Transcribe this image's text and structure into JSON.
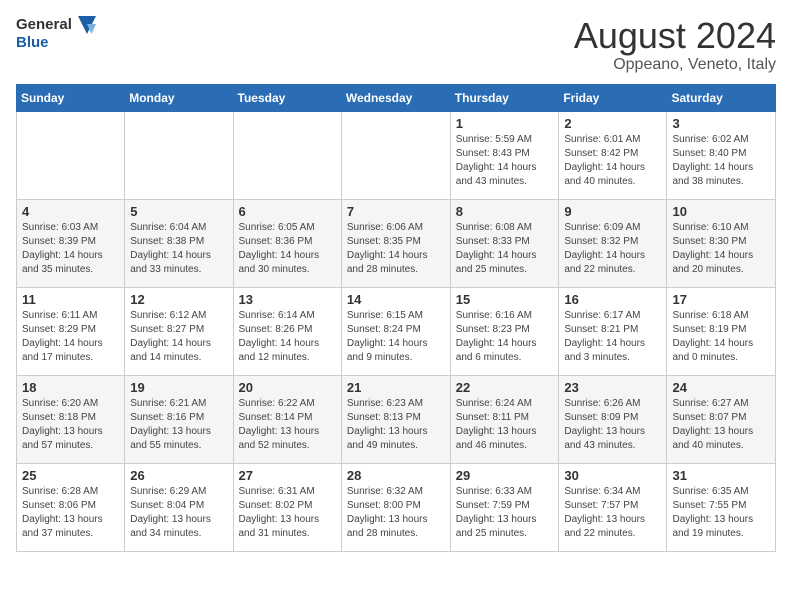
{
  "header": {
    "logo_general": "General",
    "logo_blue": "Blue",
    "main_title": "August 2024",
    "subtitle": "Oppeano, Veneto, Italy"
  },
  "calendar": {
    "days_of_week": [
      "Sunday",
      "Monday",
      "Tuesday",
      "Wednesday",
      "Thursday",
      "Friday",
      "Saturday"
    ],
    "weeks": [
      {
        "days": [
          {
            "number": "",
            "info": ""
          },
          {
            "number": "",
            "info": ""
          },
          {
            "number": "",
            "info": ""
          },
          {
            "number": "",
            "info": ""
          },
          {
            "number": "1",
            "info": "Sunrise: 5:59 AM\nSunset: 8:43 PM\nDaylight: 14 hours\nand 43 minutes."
          },
          {
            "number": "2",
            "info": "Sunrise: 6:01 AM\nSunset: 8:42 PM\nDaylight: 14 hours\nand 40 minutes."
          },
          {
            "number": "3",
            "info": "Sunrise: 6:02 AM\nSunset: 8:40 PM\nDaylight: 14 hours\nand 38 minutes."
          }
        ]
      },
      {
        "days": [
          {
            "number": "4",
            "info": "Sunrise: 6:03 AM\nSunset: 8:39 PM\nDaylight: 14 hours\nand 35 minutes."
          },
          {
            "number": "5",
            "info": "Sunrise: 6:04 AM\nSunset: 8:38 PM\nDaylight: 14 hours\nand 33 minutes."
          },
          {
            "number": "6",
            "info": "Sunrise: 6:05 AM\nSunset: 8:36 PM\nDaylight: 14 hours\nand 30 minutes."
          },
          {
            "number": "7",
            "info": "Sunrise: 6:06 AM\nSunset: 8:35 PM\nDaylight: 14 hours\nand 28 minutes."
          },
          {
            "number": "8",
            "info": "Sunrise: 6:08 AM\nSunset: 8:33 PM\nDaylight: 14 hours\nand 25 minutes."
          },
          {
            "number": "9",
            "info": "Sunrise: 6:09 AM\nSunset: 8:32 PM\nDaylight: 14 hours\nand 22 minutes."
          },
          {
            "number": "10",
            "info": "Sunrise: 6:10 AM\nSunset: 8:30 PM\nDaylight: 14 hours\nand 20 minutes."
          }
        ]
      },
      {
        "days": [
          {
            "number": "11",
            "info": "Sunrise: 6:11 AM\nSunset: 8:29 PM\nDaylight: 14 hours\nand 17 minutes."
          },
          {
            "number": "12",
            "info": "Sunrise: 6:12 AM\nSunset: 8:27 PM\nDaylight: 14 hours\nand 14 minutes."
          },
          {
            "number": "13",
            "info": "Sunrise: 6:14 AM\nSunset: 8:26 PM\nDaylight: 14 hours\nand 12 minutes."
          },
          {
            "number": "14",
            "info": "Sunrise: 6:15 AM\nSunset: 8:24 PM\nDaylight: 14 hours\nand 9 minutes."
          },
          {
            "number": "15",
            "info": "Sunrise: 6:16 AM\nSunset: 8:23 PM\nDaylight: 14 hours\nand 6 minutes."
          },
          {
            "number": "16",
            "info": "Sunrise: 6:17 AM\nSunset: 8:21 PM\nDaylight: 14 hours\nand 3 minutes."
          },
          {
            "number": "17",
            "info": "Sunrise: 6:18 AM\nSunset: 8:19 PM\nDaylight: 14 hours\nand 0 minutes."
          }
        ]
      },
      {
        "days": [
          {
            "number": "18",
            "info": "Sunrise: 6:20 AM\nSunset: 8:18 PM\nDaylight: 13 hours\nand 57 minutes."
          },
          {
            "number": "19",
            "info": "Sunrise: 6:21 AM\nSunset: 8:16 PM\nDaylight: 13 hours\nand 55 minutes."
          },
          {
            "number": "20",
            "info": "Sunrise: 6:22 AM\nSunset: 8:14 PM\nDaylight: 13 hours\nand 52 minutes."
          },
          {
            "number": "21",
            "info": "Sunrise: 6:23 AM\nSunset: 8:13 PM\nDaylight: 13 hours\nand 49 minutes."
          },
          {
            "number": "22",
            "info": "Sunrise: 6:24 AM\nSunset: 8:11 PM\nDaylight: 13 hours\nand 46 minutes."
          },
          {
            "number": "23",
            "info": "Sunrise: 6:26 AM\nSunset: 8:09 PM\nDaylight: 13 hours\nand 43 minutes."
          },
          {
            "number": "24",
            "info": "Sunrise: 6:27 AM\nSunset: 8:07 PM\nDaylight: 13 hours\nand 40 minutes."
          }
        ]
      },
      {
        "days": [
          {
            "number": "25",
            "info": "Sunrise: 6:28 AM\nSunset: 8:06 PM\nDaylight: 13 hours\nand 37 minutes."
          },
          {
            "number": "26",
            "info": "Sunrise: 6:29 AM\nSunset: 8:04 PM\nDaylight: 13 hours\nand 34 minutes."
          },
          {
            "number": "27",
            "info": "Sunrise: 6:31 AM\nSunset: 8:02 PM\nDaylight: 13 hours\nand 31 minutes."
          },
          {
            "number": "28",
            "info": "Sunrise: 6:32 AM\nSunset: 8:00 PM\nDaylight: 13 hours\nand 28 minutes."
          },
          {
            "number": "29",
            "info": "Sunrise: 6:33 AM\nSunset: 7:59 PM\nDaylight: 13 hours\nand 25 minutes."
          },
          {
            "number": "30",
            "info": "Sunrise: 6:34 AM\nSunset: 7:57 PM\nDaylight: 13 hours\nand 22 minutes."
          },
          {
            "number": "31",
            "info": "Sunrise: 6:35 AM\nSunset: 7:55 PM\nDaylight: 13 hours\nand 19 minutes."
          }
        ]
      }
    ]
  }
}
